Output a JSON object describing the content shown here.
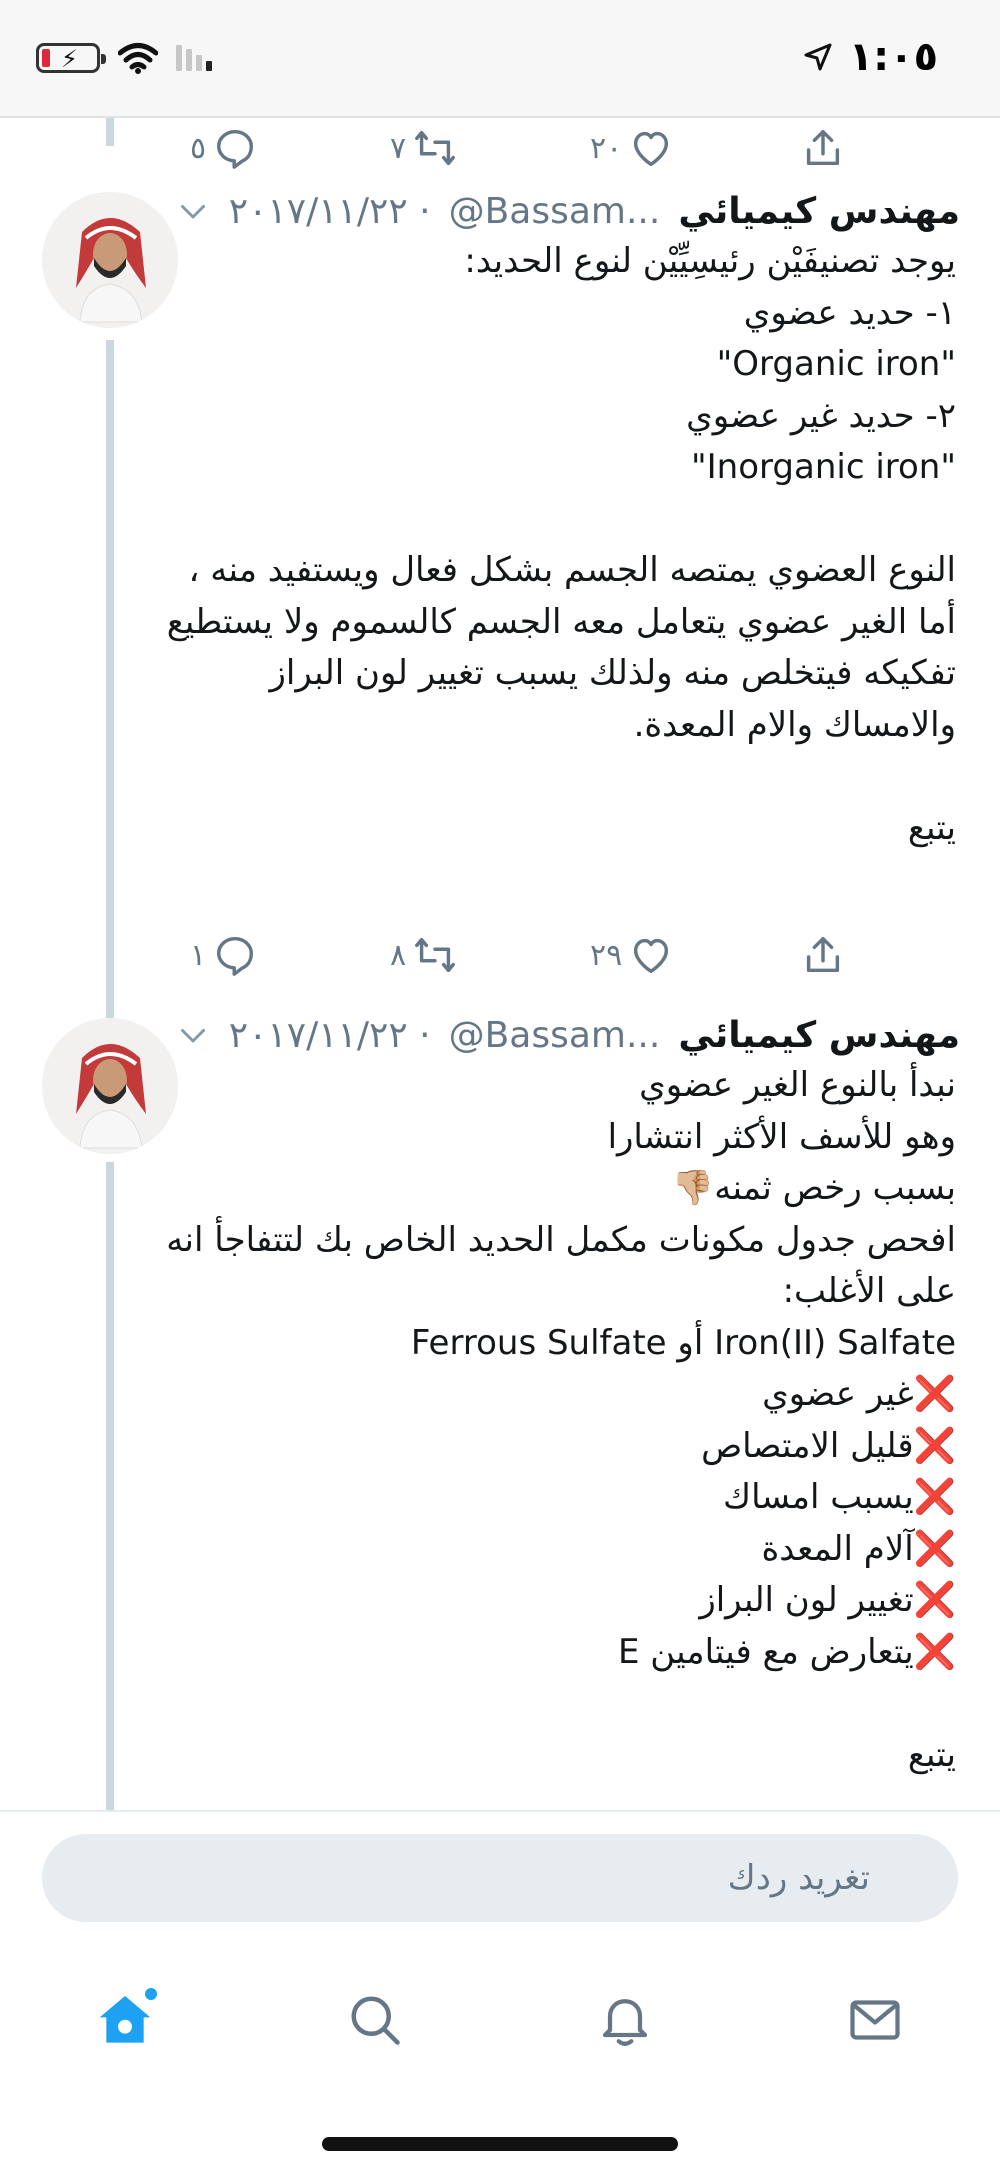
{
  "status_bar": {
    "time": "١:٠٥",
    "battery_level": 0.1,
    "battery_icon": "battery-charging-icon",
    "wifi_icon": "wifi-icon",
    "signal_bars_on": 1,
    "location_icon": "location-arrow-icon"
  },
  "colors": {
    "accent": "#1da1f2",
    "thread_line": "#ccd6dd",
    "secondary_text": "#657786",
    "danger": "#e0283c"
  },
  "top_actions": {
    "replies": "٥",
    "retweets": "٧",
    "likes": "٢٠"
  },
  "tweets": [
    {
      "name": "مهندس كيميائي",
      "handle": "@Bassam...",
      "date": "٢٠١٧/١١/٢٢ ·",
      "text": "يوجد تصنيفَيْن رئيسِيِّيْن لنوع الحديد:\n١- حديد عضوي\n\"Organic iron\"\n٢- حديد غير عضوي\n\"Inorganic iron\"\n\nالنوع العضوي يمتصه الجسم بشكل فعال ويستفيد منه ، أما الغير عضوي يتعامل معه الجسم كالسموم ولا يستطيع تفكيكه فيتخلص منه ولذلك يسبب تغيير لون البراز والامساك والام المعدة.\n\nيتبع",
      "replies": "١",
      "retweets": "٨",
      "likes": "٢٩"
    },
    {
      "name": "مهندس كيميائي",
      "handle": "@Bassam...",
      "date": "٢٠١٧/١١/٢٢ ·",
      "text": "نبدأ بالنوع الغير عضوي\nوهو للأسف الأكثر انتشارا\nبسبب رخص ثمنه👎🏼\nافحص جدول مكونات مكمل الحديد الخاص بك لتتفاجأ انه على الأغلب:\nIron(II) Salfate أو Ferrous Sulfate\n❌غير عضوي\n❌قليل الامتصاص\n❌يسبب امساك\n❌آلام المعدة\n❌تغيير لون البراز\n❌يتعارض مع فيتامين E\n\nيتبع"
    }
  ],
  "reply": {
    "placeholder": "تغريد ردك"
  },
  "tabs": [
    {
      "name": "home",
      "icon": "home-icon",
      "active": true
    },
    {
      "name": "search",
      "icon": "search-icon",
      "active": false
    },
    {
      "name": "notifications",
      "icon": "bell-icon",
      "active": false
    },
    {
      "name": "messages",
      "icon": "mail-icon",
      "active": false
    }
  ]
}
